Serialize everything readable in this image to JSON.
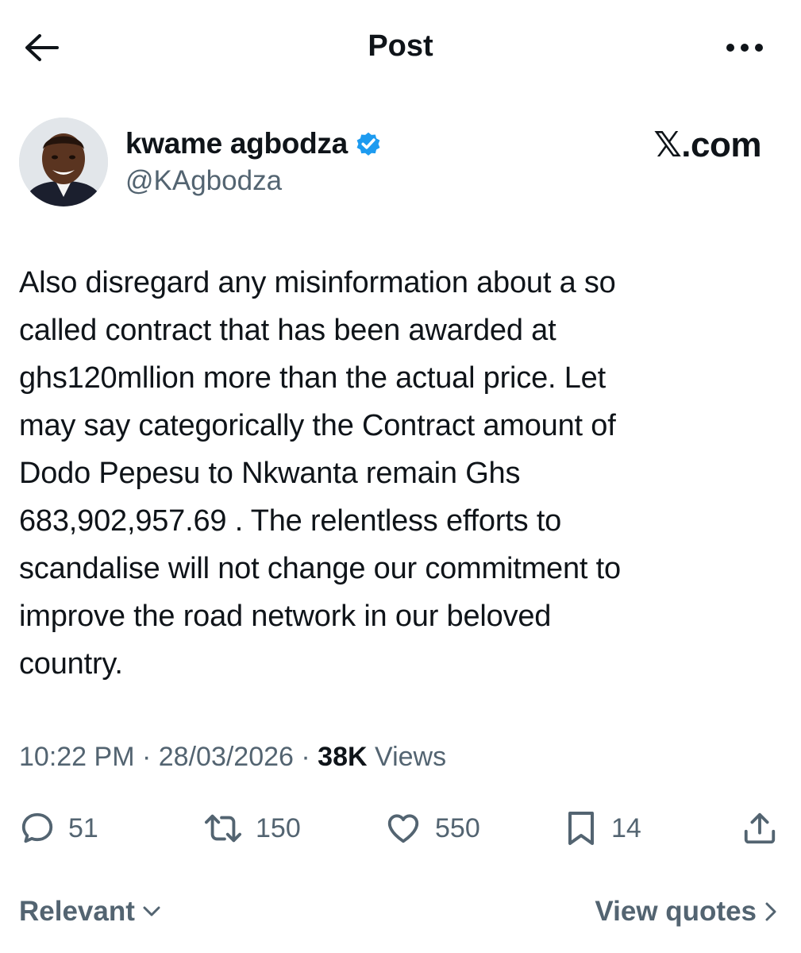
{
  "header": {
    "title": "Post",
    "back_icon": "arrow-left-icon",
    "more_icon": "ellipsis-icon"
  },
  "author": {
    "display_name": "kwame agbodza",
    "handle": "@KAgbodza",
    "verified": true,
    "verified_color": "#1d9bf0",
    "source_logo": "𝕏.com"
  },
  "post": {
    "text": "Also disregard any misinformation about a so\ncalled contract that has been awarded at\nghs120mllion more than the actual price. Let\nmay say categorically the Contract amount of\nDodo Pepesu to Nkwanta remain Ghs\n683,902,957.69 . The relentless efforts to\nscandalise will not change our commitment to\nimprove the road network in our beloved\ncountry.",
    "time": "10:22 PM",
    "separator": "·",
    "date": "28/03/2026",
    "views_count": "38K",
    "views_label": "Views"
  },
  "actions": {
    "replies": "51",
    "reposts": "150",
    "likes": "550",
    "bookmarks": "14",
    "icons": [
      "reply-icon",
      "repost-icon",
      "like-icon",
      "bookmark-icon",
      "share-icon"
    ],
    "icon_color": "#536471"
  },
  "footer": {
    "sort_label": "Relevant",
    "view_quotes_label": "View quotes"
  }
}
